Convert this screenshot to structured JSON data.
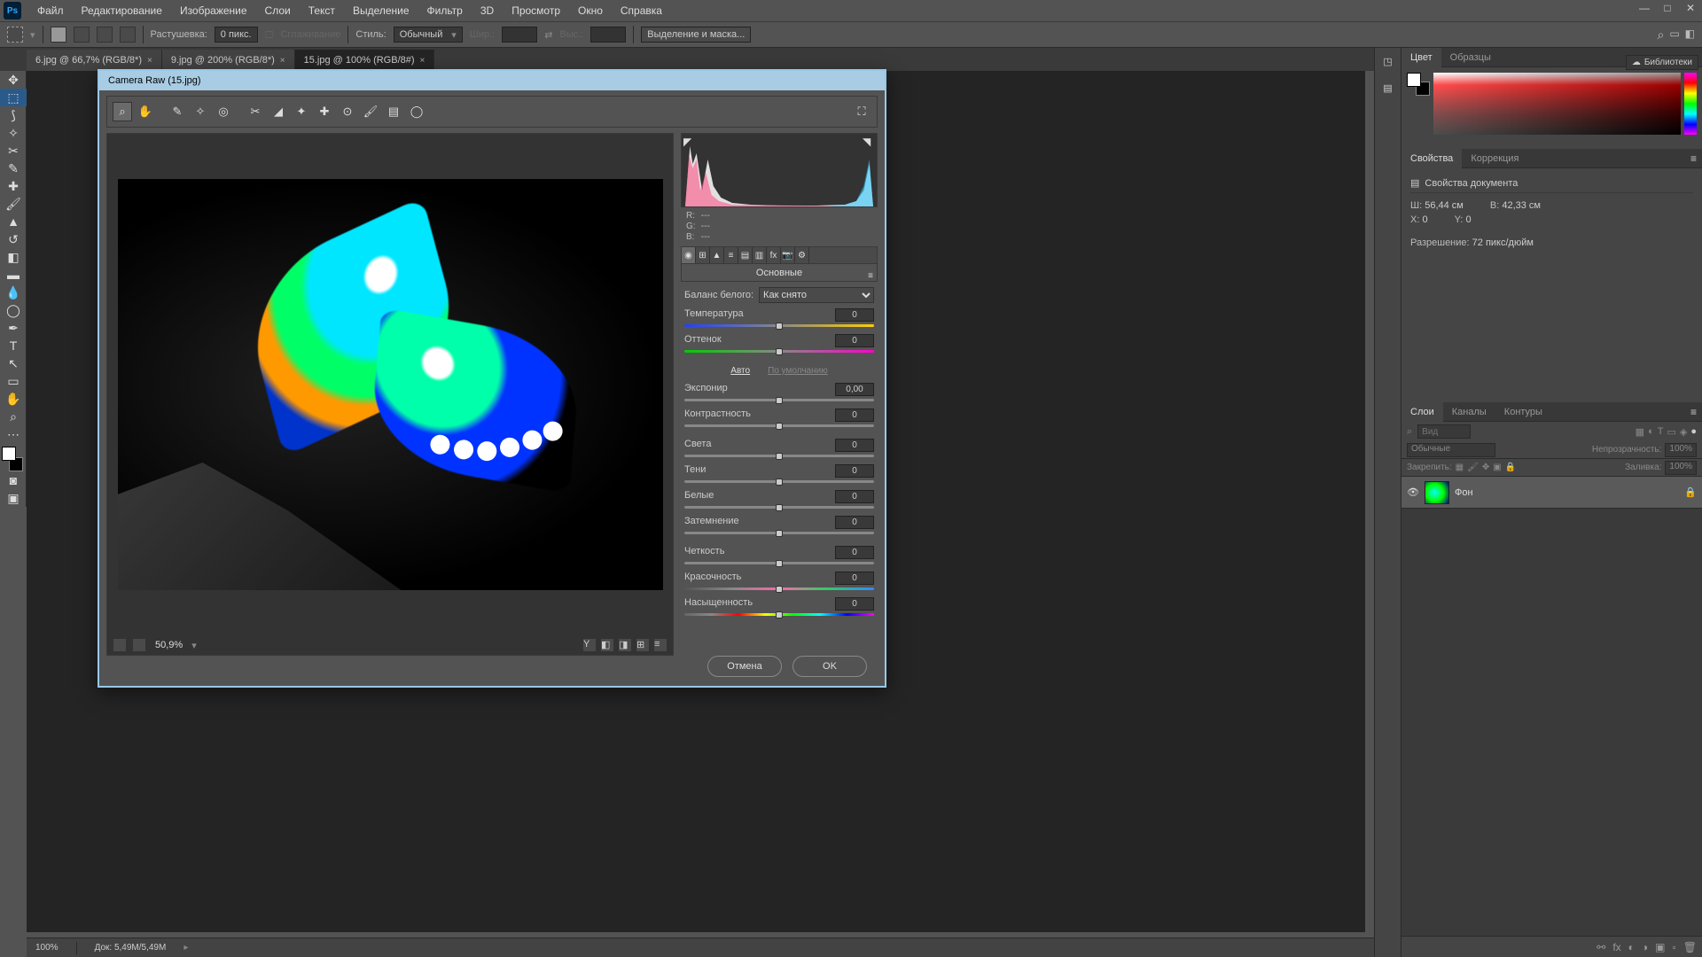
{
  "menu": {
    "items": [
      "Файл",
      "Редактирование",
      "Изображение",
      "Слои",
      "Текст",
      "Выделение",
      "Фильтр",
      "3D",
      "Просмотр",
      "Окно",
      "Справка"
    ]
  },
  "options": {
    "feather_label": "Растушевка:",
    "feather_value": "0 пикс.",
    "antialias_label": "Сглаживание",
    "style_label": "Стиль:",
    "style_value": "Обычный",
    "width_label": "Шир.:",
    "height_label": "Выс.:",
    "refine_edge": "Выделение и маска..."
  },
  "tabs": [
    {
      "label": "6.jpg @ 66,7% (RGB/8*)",
      "active": false
    },
    {
      "label": "9.jpg @ 200% (RGB/8*)",
      "active": false
    },
    {
      "label": "15.jpg @ 100% (RGB/8#)",
      "active": true
    }
  ],
  "camera_raw": {
    "title": "Camera Raw (15.jpg)",
    "zoom": "50,9%",
    "readout": {
      "r": "R:",
      "g": "G:",
      "b": "B:",
      "dash": "---"
    },
    "panel_title": "Основные",
    "wb_label": "Баланс белого:",
    "wb_value": "Как снято",
    "auto": "Авто",
    "default": "По умолчанию",
    "sliders": {
      "temperature": {
        "label": "Температура",
        "value": "0"
      },
      "tint": {
        "label": "Оттенок",
        "value": "0"
      },
      "exposure": {
        "label": "Экспонир",
        "value": "0,00"
      },
      "contrast": {
        "label": "Контрастность",
        "value": "0"
      },
      "highlights": {
        "label": "Света",
        "value": "0"
      },
      "shadows": {
        "label": "Тени",
        "value": "0"
      },
      "whites": {
        "label": "Белые",
        "value": "0"
      },
      "blacks": {
        "label": "Затемнение",
        "value": "0"
      },
      "clarity": {
        "label": "Четкость",
        "value": "0"
      },
      "vibrance": {
        "label": "Красочность",
        "value": "0"
      },
      "saturation": {
        "label": "Насыщенность",
        "value": "0"
      }
    },
    "cancel": "Отмена",
    "ok": "OK"
  },
  "right": {
    "color_tab": "Цвет",
    "swatches_tab": "Образцы",
    "libraries": "Библиотеки",
    "props_tab": "Свойства",
    "adjust_tab": "Коррекция",
    "props_header": "Свойства документа",
    "w_label": "Ш:",
    "w_value": "56,44 см",
    "h_label": "В:",
    "h_value": "42,33 см",
    "x_label": "X:",
    "x_value": "0",
    "y_label": "Y:",
    "y_value": "0",
    "res_label": "Разрешение:",
    "res_value": "72 пикс/дюйм",
    "layers_tab": "Слои",
    "channels_tab": "Каналы",
    "paths_tab": "Контуры",
    "search_placeholder": "Вид",
    "blend_mode": "Обычные",
    "opacity_label": "Непрозрачность:",
    "opacity_value": "100%",
    "lock_label": "Закрепить:",
    "fill_label": "Заливка:",
    "fill_value": "100%",
    "layer_name": "Фон"
  },
  "status": {
    "zoom": "100%",
    "doc": "Док: 5,49M/5,49M"
  }
}
